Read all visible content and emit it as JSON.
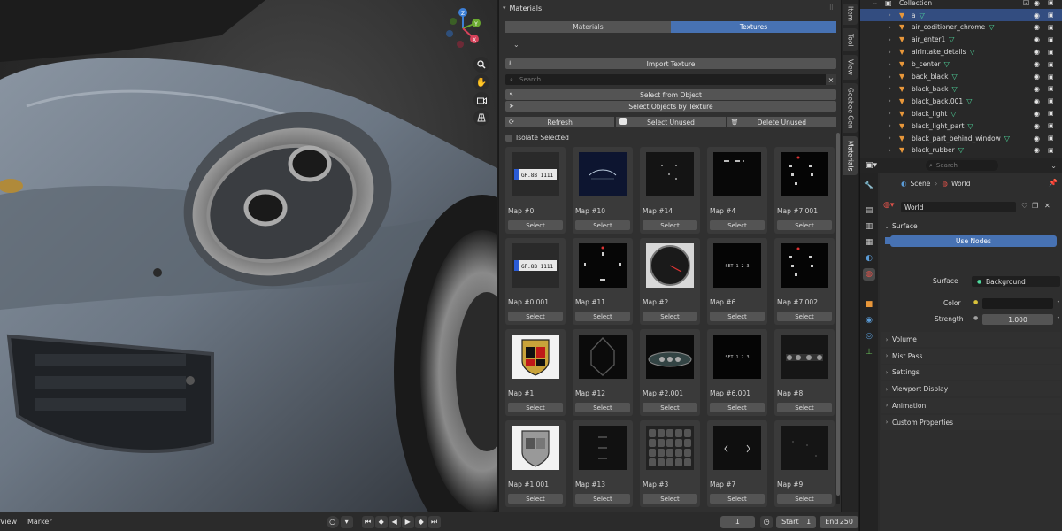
{
  "viewport": {
    "tools": [
      "zoom-icon",
      "hand-icon",
      "camera-icon",
      "grid-icon"
    ],
    "gizmo_axes": [
      "Z",
      "Y",
      "X"
    ]
  },
  "timeline": {
    "menu_view": "View",
    "menu_marker": "Marker",
    "current_frame": "1",
    "start_label": "Start",
    "start_value": "1",
    "end_label": "End",
    "end_value": "250"
  },
  "materials_panel": {
    "title": "Materials",
    "tabs": [
      {
        "label": "Materials",
        "active": false
      },
      {
        "label": "Textures",
        "active": true
      }
    ],
    "import_label": "Import Texture",
    "search_placeholder": "Search",
    "select_from_object": "Select from Object",
    "select_by_texture": "Select Objects by Texture",
    "refresh": "Refresh",
    "select_unused": "Select Unused",
    "delete_unused": "Delete Unused",
    "isolate_label": "Isolate Selected",
    "select_label": "Select",
    "textures": [
      {
        "name": "Map #0",
        "thumb": "plate"
      },
      {
        "name": "Map #10",
        "thumb": "carlogo"
      },
      {
        "name": "Map #14",
        "thumb": "dots"
      },
      {
        "name": "Map #4",
        "thumb": "dots2"
      },
      {
        "name": "Map #7.001",
        "thumb": "gauges"
      },
      {
        "name": "Map #0.001",
        "thumb": "plate"
      },
      {
        "name": "Map #11",
        "thumb": "gauge2"
      },
      {
        "name": "Map #2",
        "thumb": "dial"
      },
      {
        "name": "Map #6",
        "thumb": "digits"
      },
      {
        "name": "Map #7.002",
        "thumb": "gauges"
      },
      {
        "name": "Map #1",
        "thumb": "crest"
      },
      {
        "name": "Map #12",
        "thumb": "hex"
      },
      {
        "name": "Map #2.001",
        "thumb": "dash"
      },
      {
        "name": "Map #6.001",
        "thumb": "digits"
      },
      {
        "name": "Map #8",
        "thumb": "knobs"
      },
      {
        "name": "Map #1.001",
        "thumb": "crestgray"
      },
      {
        "name": "Map #13",
        "thumb": "dark"
      },
      {
        "name": "Map #3",
        "thumb": "grid"
      },
      {
        "name": "Map #7",
        "thumb": "brackets"
      },
      {
        "name": "Map #9",
        "thumb": "faint"
      }
    ],
    "plate_text": "GP.8B 1111",
    "digits_text": "SET 1 2 3"
  },
  "side_tabs": [
    "Item",
    "Tool",
    "View",
    "Geebee Gen",
    "Materials"
  ],
  "outliner": {
    "rows": [
      {
        "name": "Collection",
        "kind": "collection"
      },
      {
        "name": "a",
        "kind": "object",
        "selected": true
      },
      {
        "name": "air_coditioner_chrome",
        "kind": "object"
      },
      {
        "name": "air_enter1",
        "kind": "object"
      },
      {
        "name": "airintake_details",
        "kind": "object"
      },
      {
        "name": "b_center",
        "kind": "object"
      },
      {
        "name": "back_black",
        "kind": "object"
      },
      {
        "name": "black_back",
        "kind": "object"
      },
      {
        "name": "black_back.001",
        "kind": "object"
      },
      {
        "name": "black_light",
        "kind": "object"
      },
      {
        "name": "black_light_part",
        "kind": "object"
      },
      {
        "name": "black_part_behind_window",
        "kind": "object"
      },
      {
        "name": "black_rubber",
        "kind": "object"
      }
    ]
  },
  "properties": {
    "search_placeholder": "Search",
    "breadcrumb_scene": "Scene",
    "breadcrumb_world": "World",
    "world_name": "World",
    "surface_title": "Surface",
    "use_nodes": "Use Nodes",
    "surface_label": "Surface",
    "surface_value": "Background",
    "color_label": "Color",
    "strength_label": "Strength",
    "strength_value": "1.000",
    "sections": [
      "Volume",
      "Mist Pass",
      "Settings",
      "Viewport Display",
      "Animation",
      "Custom Properties"
    ],
    "accent": "#4772b3"
  }
}
